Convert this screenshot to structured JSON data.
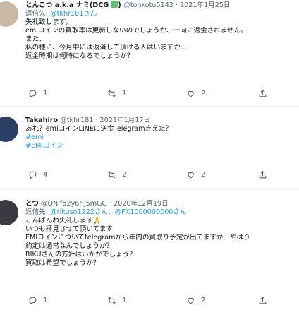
{
  "tweets": [
    {
      "name": "とんこつ a.k.a ナミ(DCG",
      "badges": "♻️✖️)",
      "handle": "@tonkotu5142",
      "date": "· 2021年1月25日",
      "reply_prefix": "返信先:",
      "reply_to": "@tkhr181さん",
      "lines": [
        "失礼致します。",
        "emiコインの買取率は更新しないのでしょうか、一向に返金されません。",
        "また、",
        "私の様に、今月中には返済して頂ける人はいますか…",
        "返金時期は何時になるでしょうか？"
      ],
      "counts": {
        "reply": "1",
        "retweet": "1",
        "like": "2"
      },
      "avatar_color": "#c9b8a6"
    },
    {
      "name": "Takahiro",
      "handle": "@tkhr181",
      "date": "· 2021年1月17日",
      "lines": [
        "あれ？emiコインLINEに送金Telegramきえた？"
      ],
      "tags": [
        "#emi",
        "#EMIコイン"
      ],
      "counts": {
        "reply": "4",
        "retweet": "2",
        "like": "2"
      },
      "avatar_color": "#2a3f63"
    },
    {
      "name": "とつ",
      "handle": "@QNIf52y6rij5mGG",
      "date": "· 2020年12月19日",
      "reply_prefix": "返信先:",
      "reply_to": "@rikuso1222さん、@FX1000000000さん",
      "lines": [
        "こんばんわ失礼します🙏",
        "いつも拝見させて頂いてます",
        "EMIコインについてtelegramから年内の買取り予定が出てますが、やはり",
        "約定は通常なんでしょうか？",
        "RIKUさんの方針はいかがでしょう？",
        "買取は希望でしょうか？"
      ],
      "counts": {
        "reply": "1",
        "retweet": "1",
        "like": "2"
      },
      "avatar_color": "#3a3a40"
    }
  ]
}
